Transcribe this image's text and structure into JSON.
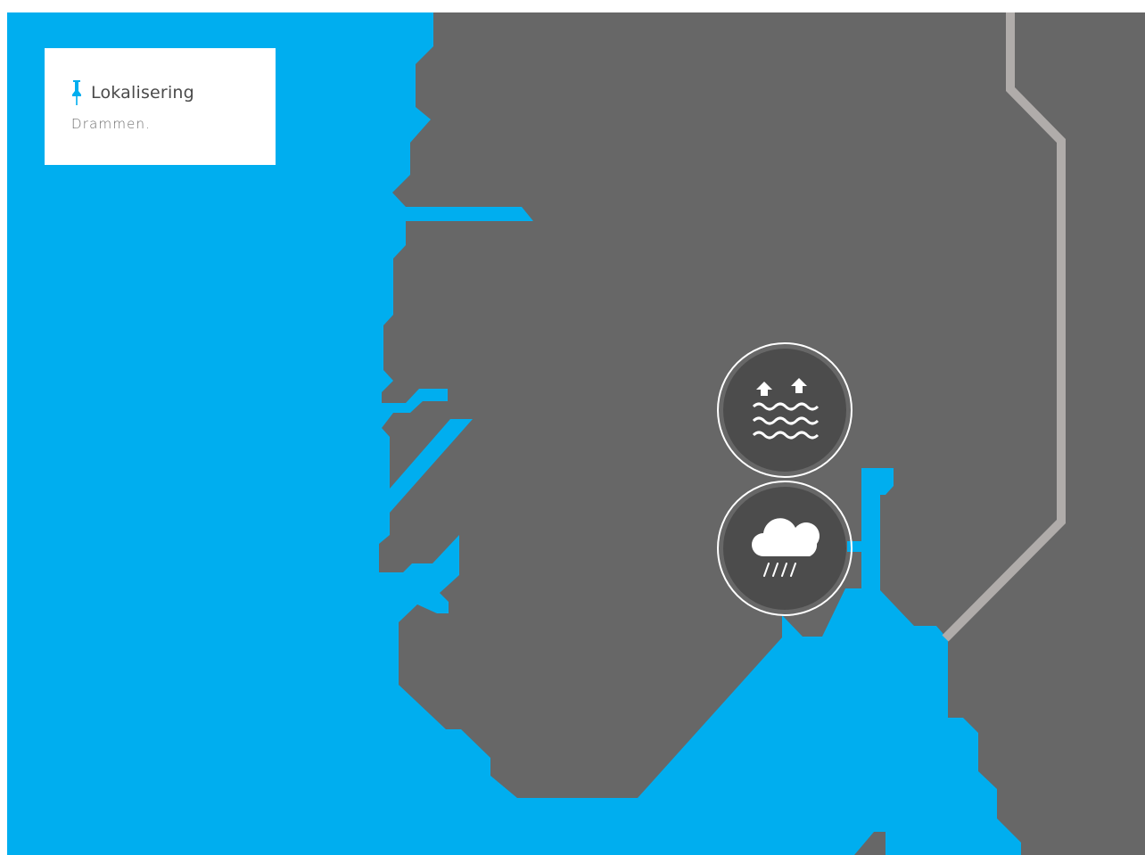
{
  "location_card": {
    "icon": "pushpin-icon",
    "title": "Lokalisering",
    "text": "Drammen."
  },
  "markers": [
    {
      "name": "sea-level-rise",
      "icon": "sea-level-rise-icon"
    },
    {
      "name": "heavy-rain",
      "icon": "rain-cloud-icon"
    }
  ],
  "colors": {
    "water": "#00aeef",
    "land": "#676767",
    "road": "#b0acaa",
    "marker_fill": "#4c4c4c",
    "card": "#ffffff",
    "accent": "#00aeef"
  }
}
